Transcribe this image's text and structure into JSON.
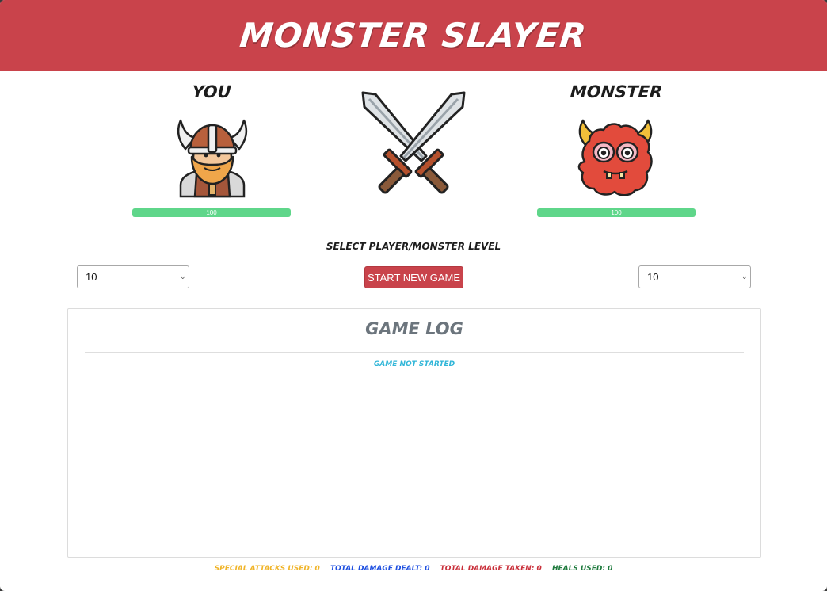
{
  "app": {
    "title": "MONSTER SLAYER"
  },
  "player": {
    "name": "YOU",
    "health": 100,
    "health_label": "100"
  },
  "monster": {
    "name": "MONSTER",
    "health": 100,
    "health_label": "100"
  },
  "level": {
    "title": "SELECT PLAYER/MONSTER LEVEL",
    "player_value": "10",
    "monster_value": "10"
  },
  "actions": {
    "start_label": "START NEW GAME"
  },
  "log": {
    "title": "GAME LOG",
    "status": "GAME NOT STARTED"
  },
  "stats": {
    "special_label": "SPECIAL ATTACKS USED: 0",
    "dealt_label": "TOTAL DAMAGE DEALT: 0",
    "taken_label": "TOTAL DAMAGE TAKEN: 0",
    "heals_label": "HEALS USED: 0"
  },
  "colors": {
    "header": "#c9434b",
    "health": "#5fd68a",
    "special": "#f0b429",
    "dealt": "#1e4fe0",
    "taken": "#c9303b",
    "heals": "#1e7a3d",
    "log_status": "#31b6d8"
  },
  "icons": {
    "player_avatar": "viking-icon",
    "versus": "crossed-swords-icon",
    "monster_avatar": "monster-icon"
  }
}
